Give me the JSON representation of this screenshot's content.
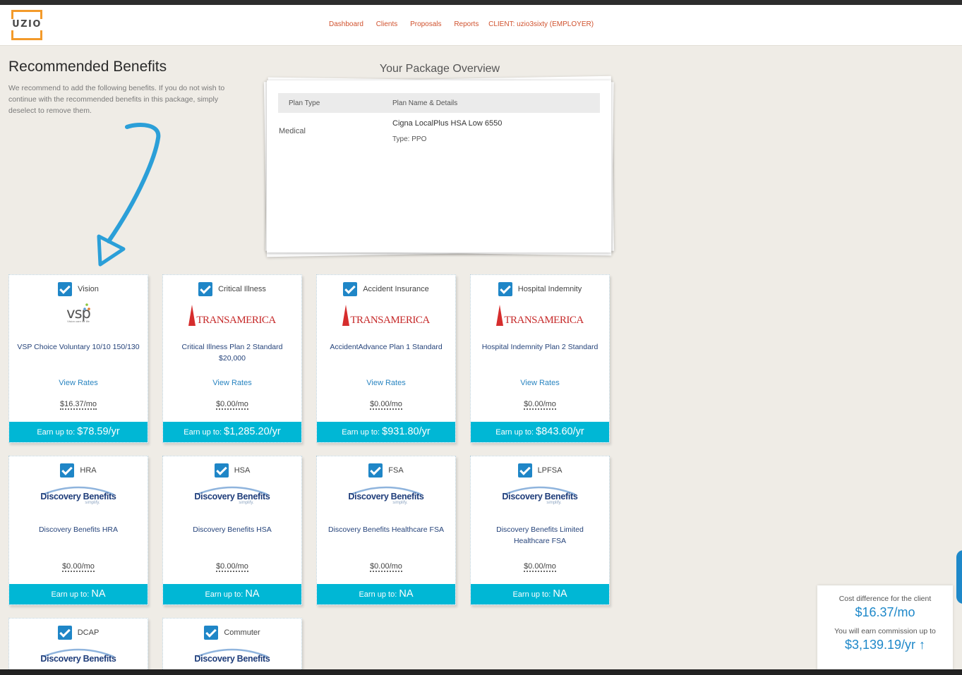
{
  "header": {
    "logo_text": "UZIO",
    "nav": [
      "Dashboard",
      "Clients",
      "Proposals",
      "Reports"
    ],
    "client": "CLIENT: uzio3sixty (EMPLOYER)"
  },
  "page": {
    "title": "Recommended Benefits",
    "description": "We recommend to add the following benefits. If you do not wish to continue with the recommended benefits in this package, simply deselect to remove them."
  },
  "overview": {
    "title": "Your Package Overview",
    "col_plan_type": "Plan Type",
    "col_plan_name": "Plan Name & Details",
    "rows": [
      {
        "type": "Medical",
        "name": "Cigna LocalPlus HSA Low 6550",
        "sub": "Type: PPO"
      }
    ]
  },
  "cards": [
    {
      "category": "Vision",
      "logo": "vsp-logo",
      "logo_text": "VSP",
      "logo_tagline": "Vision care for life",
      "plan": "VSP Choice Voluntary 10/10 150/130",
      "view_rates": "View Rates",
      "price": "$16.37/mo",
      "earn_label": "Earn up to:",
      "earn_value": "$78.59/yr",
      "checked": true
    },
    {
      "category": "Critical Illness",
      "logo": "transamerica-logo",
      "logo_text": "TRANSAMERICA",
      "plan": "Critical Illness Plan 2 Standard $20,000",
      "view_rates": "View Rates",
      "price": "$0.00/mo",
      "earn_label": "Earn up to:",
      "earn_value": "$1,285.20/yr",
      "checked": true
    },
    {
      "category": "Accident Insurance",
      "logo": "transamerica-logo",
      "logo_text": "TRANSAMERICA",
      "plan": "AccidentAdvance Plan 1 Standard",
      "view_rates": "View Rates",
      "price": "$0.00/mo",
      "earn_label": "Earn up to:",
      "earn_value": "$931.80/yr",
      "checked": true
    },
    {
      "category": "Hospital Indemnity",
      "logo": "transamerica-logo",
      "logo_text": "TRANSAMERICA",
      "plan": "Hospital Indemnity Plan 2 Standard",
      "view_rates": "View Rates",
      "price": "$0.00/mo",
      "earn_label": "Earn up to:",
      "earn_value": "$843.60/yr",
      "checked": true
    },
    {
      "category": "HRA",
      "logo": "discovery-benefits-logo",
      "logo_text": "Discovery Benefits",
      "logo_tagline": "simplify.",
      "plan": "Discovery Benefits HRA",
      "price": "$0.00/mo",
      "earn_label": "Earn up to:",
      "earn_value": "NA",
      "checked": true
    },
    {
      "category": "HSA",
      "logo": "discovery-benefits-logo",
      "logo_text": "Discovery Benefits",
      "logo_tagline": "simplify.",
      "plan": "Discovery Benefits HSA",
      "price": "$0.00/mo",
      "earn_label": "Earn up to:",
      "earn_value": "NA",
      "checked": true
    },
    {
      "category": "FSA",
      "logo": "discovery-benefits-logo",
      "logo_text": "Discovery Benefits",
      "logo_tagline": "simplify.",
      "plan": "Discovery Benefits Healthcare FSA",
      "price": "$0.00/mo",
      "earn_label": "Earn up to:",
      "earn_value": "NA",
      "checked": true
    },
    {
      "category": "LPFSA",
      "logo": "discovery-benefits-logo",
      "logo_text": "Discovery Benefits",
      "logo_tagline": "simplify.",
      "plan": "Discovery Benefits Limited Healthcare FSA",
      "price": "$0.00/mo",
      "earn_label": "Earn up to:",
      "earn_value": "NA",
      "checked": true
    },
    {
      "category": "DCAP",
      "logo": "discovery-benefits-logo",
      "logo_text": "Discovery Benefits",
      "checked": true
    },
    {
      "category": "Commuter",
      "logo": "discovery-benefits-logo",
      "logo_text": "Discovery Benefits",
      "checked": true
    }
  ],
  "summary": {
    "cost_label": "Cost difference for the client",
    "cost_value": "$16.37/mo",
    "commission_label": "You will earn commission up to",
    "commission_value": "$3,139.19/yr ↑"
  },
  "colors": {
    "accent": "#00b7d5",
    "link": "#2a85c1",
    "nav": "#d0522e",
    "checkbox": "#1f86c7",
    "logo_orange": "#f39a2a"
  }
}
